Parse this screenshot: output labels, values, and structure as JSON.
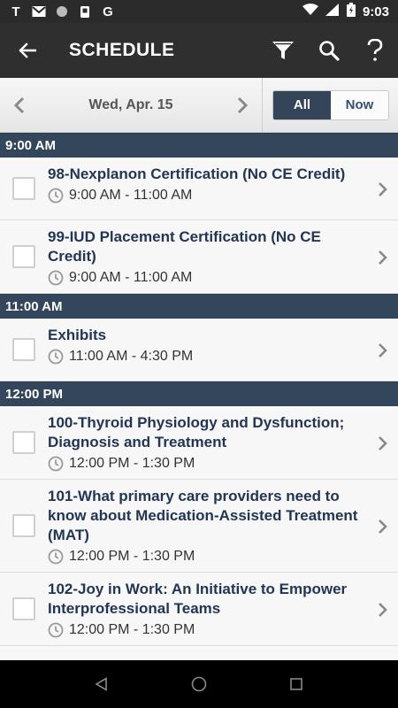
{
  "status": {
    "left_icons": [
      "T",
      "gmail-icon",
      "circle-icon",
      "device-icon",
      "G"
    ],
    "time": "9:03"
  },
  "appbar": {
    "title": "SCHEDULE"
  },
  "datebar": {
    "date": "Wed, Apr. 15",
    "toggle_all": "All",
    "toggle_now": "Now",
    "selected": "All"
  },
  "schedule": {
    "groups": [
      {
        "header": "9:00  AM",
        "items": [
          {
            "title": "98-Nexplanon Certification (No CE Credit)",
            "time": "9:00 AM - 11:00 AM"
          },
          {
            "title": "99-IUD Placement Certification (No CE Credit)",
            "time": "9:00 AM - 11:00 AM"
          }
        ]
      },
      {
        "header": "11:00  AM",
        "items": [
          {
            "title": "Exhibits",
            "time": "11:00 AM - 4:30 PM"
          }
        ]
      },
      {
        "header": "12:00  PM",
        "items": [
          {
            "title": "100-Thyroid Physiology and Dysfunction; Diagnosis and Treatment",
            "time": "12:00 PM - 1:30 PM"
          },
          {
            "title": "101-What primary care providers need to know about Medication-Assisted Treatment (MAT)",
            "time": "12:00 PM - 1:30 PM"
          },
          {
            "title": "102-Joy in Work: An Initiative to Empower Interprofessional Teams",
            "time": "12:00 PM - 1:30 PM"
          }
        ]
      }
    ]
  },
  "colors": {
    "header_bg": "#34465b",
    "title_text": "#223654",
    "toggle_active": "#344459"
  }
}
